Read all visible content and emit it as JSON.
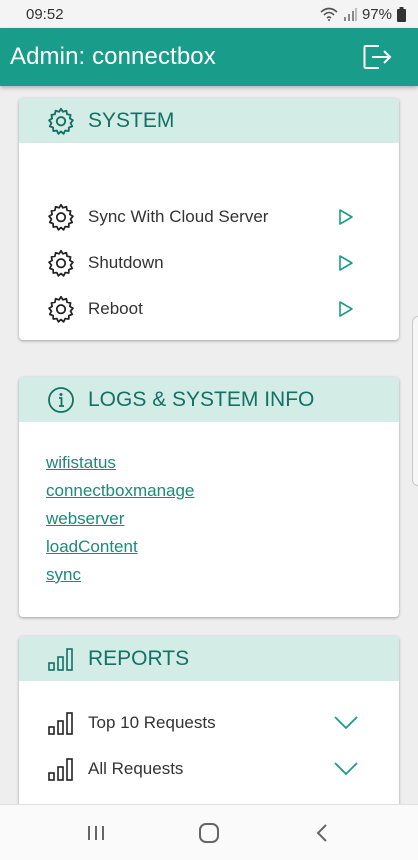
{
  "status_bar": {
    "time": "09:52",
    "battery": "97%"
  },
  "app_bar": {
    "title": "Admin: connectbox"
  },
  "system": {
    "header": "SYSTEM",
    "items": [
      {
        "label": "Sync With Cloud Server"
      },
      {
        "label": "Shutdown"
      },
      {
        "label": "Reboot"
      }
    ]
  },
  "logs": {
    "header": "LOGS & SYSTEM INFO",
    "links": [
      "wifistatus",
      "connectboxmanage",
      "webserver",
      "loadContent",
      "sync"
    ]
  },
  "reports": {
    "header": "REPORTS",
    "items": [
      {
        "label": "Top 10 Requests"
      },
      {
        "label": "All Requests"
      }
    ]
  },
  "colors": {
    "primary": "#1a9c8a",
    "header_bg": "#d3ece6",
    "accent_text": "#137265"
  }
}
